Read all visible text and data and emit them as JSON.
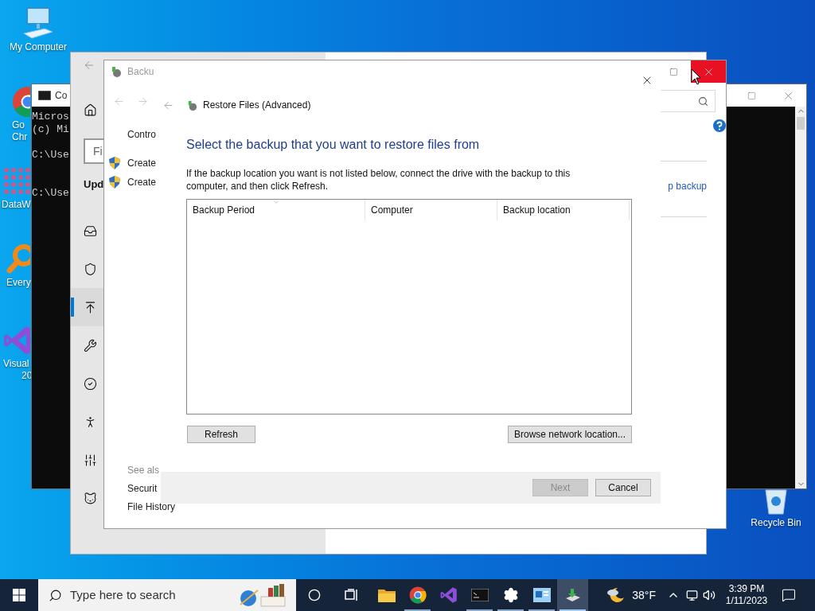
{
  "desktop": {
    "icons": [
      {
        "label": [
          "My Computer"
        ]
      },
      {
        "label": [
          "Go",
          "Chr"
        ]
      },
      {
        "label": [
          "DataW"
        ]
      },
      {
        "label": [
          "Every"
        ]
      },
      {
        "label": [
          "Visual",
          "20"
        ]
      },
      {
        "label": [
          "Recycle Bin"
        ]
      }
    ]
  },
  "console_window": {
    "title": "Co",
    "lines": [
      "Micros",
      "(c) Mi",
      "C:\\Use",
      "C:\\Use"
    ]
  },
  "settings_window": {
    "search": {
      "placeholder": "Fi"
    },
    "heading": "Upd",
    "nav": [
      {
        "selected": false
      },
      {
        "selected": false
      },
      {
        "selected": true
      },
      {
        "selected": false
      },
      {
        "selected": false
      },
      {
        "selected": false
      },
      {
        "selected": false
      },
      {
        "selected": false
      }
    ]
  },
  "control_panel": {
    "title": "Backu",
    "side_links": [
      {
        "label": "Contro",
        "kind": "plain"
      },
      {
        "label": "Create",
        "kind": "shield"
      },
      {
        "label": "Create",
        "kind": "shield"
      }
    ],
    "see_also": {
      "heading": "See als",
      "links": [
        "Securit",
        "File History"
      ]
    },
    "link": "p backup"
  },
  "dialog": {
    "title": "Restore Files (Advanced)",
    "heading": "Select the backup that you want to restore files from",
    "instructions": "If the backup location you want is not listed below, connect the drive with the backup to this computer, and then click Refresh.",
    "table": {
      "columns": [
        {
          "label": "Backup Period",
          "sorted": true
        },
        {
          "label": "Computer",
          "sorted": false
        },
        {
          "label": "Backup location",
          "sorted": false
        }
      ]
    },
    "buttons": [
      {
        "label": "Refresh",
        "disabled": false
      },
      {
        "label": "Browse network location...",
        "disabled": false
      }
    ],
    "footer_buttons": [
      {
        "label": "Next",
        "disabled": true
      },
      {
        "label": "Cancel",
        "disabled": false
      }
    ]
  },
  "taskbar": {
    "search": {
      "placeholder": "Type here to search"
    },
    "apps": [
      {
        "open": false,
        "selected": false
      },
      {
        "open": true,
        "selected": false
      },
      {
        "open": false,
        "selected": false
      },
      {
        "open": true,
        "selected": false
      },
      {
        "open": true,
        "selected": false
      },
      {
        "open": true,
        "selected": false
      },
      {
        "open": true,
        "selected": true
      }
    ],
    "weather": "38°F",
    "time": "3:39 PM",
    "date": "1/11/2023"
  }
}
